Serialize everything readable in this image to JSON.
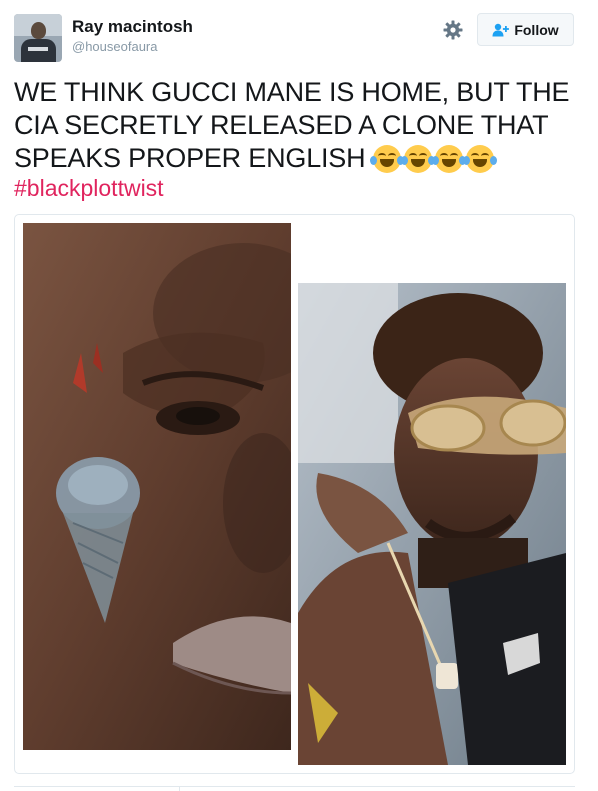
{
  "user": {
    "name": "Ray macintosh",
    "handle": "@houseofaura",
    "avatar_icon": "profile-photo"
  },
  "actions": {
    "settings_icon": "gear-icon",
    "follow_label": "Follow",
    "follow_icon": "add-user-icon",
    "accent_color": "#1da1f2"
  },
  "tweet": {
    "text": "WE THINK GUCCI MANE IS HOME, BUT THE CIA SECRETLY RELEASED A CLONE THAT SPEAKS PROPER ENGLISH",
    "emoji": "face-with-tears-of-joy",
    "emoji_count": 4,
    "hashtag": "#blackplottwist",
    "hashtag_color": "#e0245e"
  },
  "media": {
    "images": [
      {
        "name": "left-photo",
        "depicts": "face-closeup-with-ice-cream-tattoo"
      },
      {
        "name": "right-photo",
        "depicts": "man-with-gold-sunglasses"
      }
    ]
  }
}
